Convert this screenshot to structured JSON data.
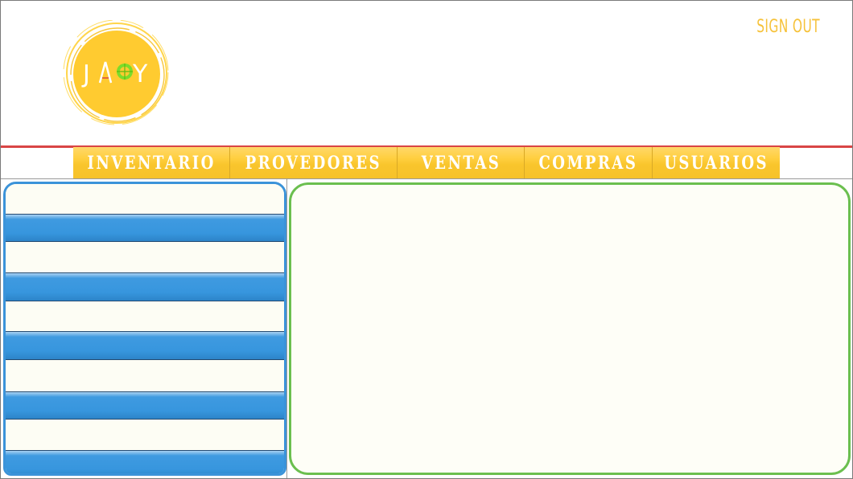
{
  "header": {
    "logo_text": "JOY",
    "signout_label": "SIGN OUT"
  },
  "nav": {
    "items": [
      {
        "label": "INVENTARIO"
      },
      {
        "label": "PROVEDORES"
      },
      {
        "label": "VENTAS"
      },
      {
        "label": "COMPRAS"
      },
      {
        "label": "USUARIOS"
      }
    ]
  },
  "sidebar": {
    "items": [
      {
        "label": "",
        "style": "light"
      },
      {
        "label": "",
        "style": "blue"
      },
      {
        "label": "",
        "style": "light"
      },
      {
        "label": "",
        "style": "blue"
      },
      {
        "label": "",
        "style": "light"
      },
      {
        "label": "",
        "style": "blue"
      },
      {
        "label": "",
        "style": "light"
      },
      {
        "label": "",
        "style": "blue"
      },
      {
        "label": "",
        "style": "light"
      },
      {
        "label": "",
        "style": "blue"
      }
    ]
  },
  "colors": {
    "accent_yellow": "#f6c23a",
    "sidebar_blue": "#3b93d9",
    "content_green": "#6bbf4f",
    "header_red_line": "#d94545"
  }
}
